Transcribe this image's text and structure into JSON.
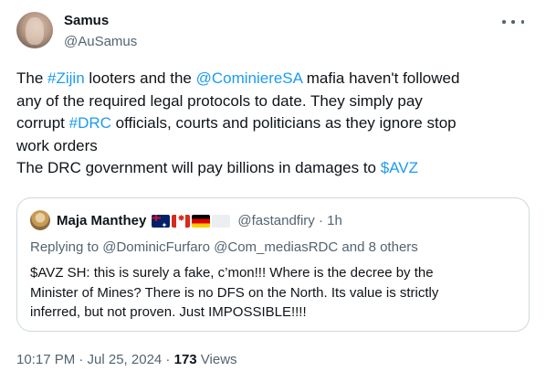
{
  "author": {
    "name": "Samus",
    "handle": "@AuSamus"
  },
  "tweet": {
    "lines": [
      [
        {
          "text": "The ",
          "link": false
        },
        {
          "text": "#Zijin",
          "link": true
        },
        {
          "text": " looters and the ",
          "link": false
        },
        {
          "text": "@CominiereSA",
          "link": true
        },
        {
          "text": " mafia haven't followed",
          "link": false
        }
      ],
      [
        {
          "text": "any of the required legal protocols to date. They simply pay",
          "link": false
        }
      ],
      [
        {
          "text": "corrupt ",
          "link": false
        },
        {
          "text": "#DRC",
          "link": true
        },
        {
          "text": " officials, courts and politicians as they ignore stop",
          "link": false
        }
      ],
      [
        {
          "text": "work orders",
          "link": false
        }
      ],
      [
        {
          "text": "The DRC government will pay billions in damages to ",
          "link": false
        },
        {
          "text": "$AVZ",
          "link": true
        }
      ]
    ]
  },
  "quote": {
    "name": "Maja Manthey",
    "flags": [
      "flag-australia-icon",
      "flag-canada-icon",
      "flag-germany-icon",
      "flag-blank-icon"
    ],
    "handle_time": "@fastandfiry · 1h",
    "replying_to": "Replying to @DominicFurfaro @Com_mediasRDC and 8 others",
    "lines": [
      "$AVZ SH: this is surely a fake, c’mon!!! Where is the decree by the",
      "Minister of Mines? There is no DFS on the North. Its value is strictly",
      "inferred, but not proven. Just IMPOSSIBLE!!!!"
    ]
  },
  "meta": {
    "timestamp": "10:17 PM · Jul 25, 2024 · ",
    "views_count": "173",
    "views_label": " Views"
  },
  "colors": {
    "link": "#1d9bf0",
    "secondary_text": "#536471",
    "primary_text": "#0f1419",
    "border": "#cfd9de"
  }
}
